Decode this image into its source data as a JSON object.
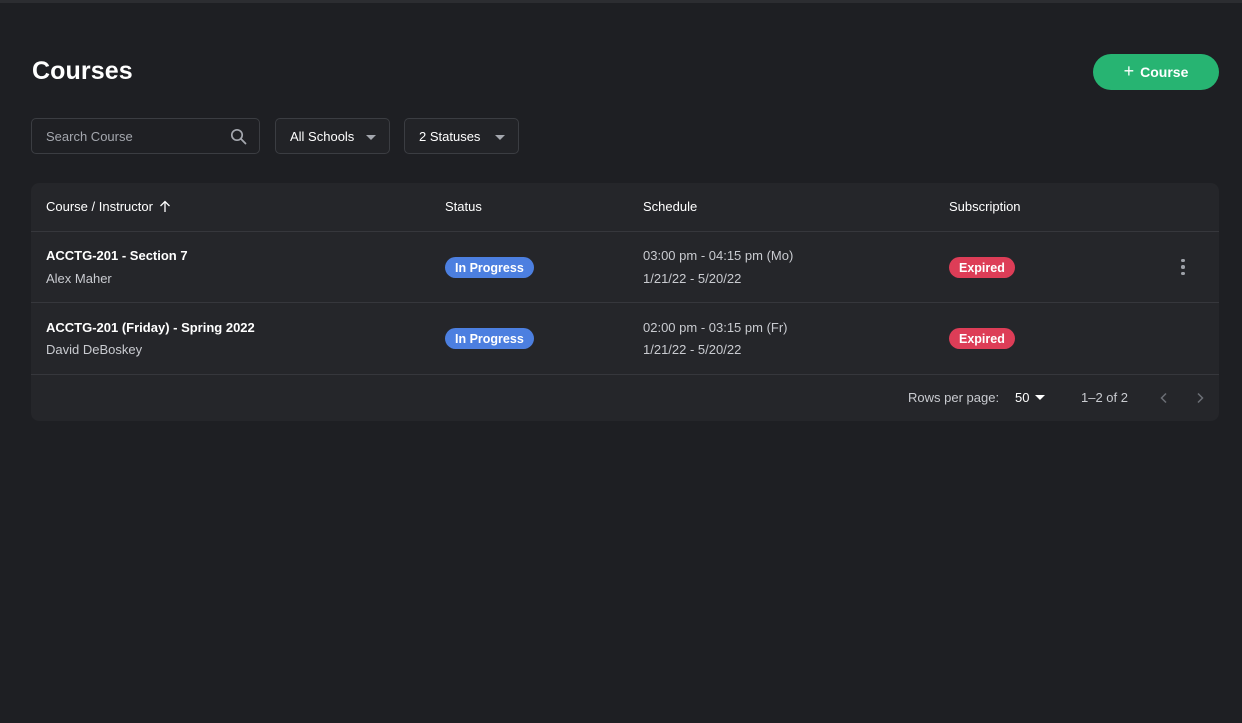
{
  "header": {
    "title": "Courses",
    "add_button": {
      "icon": "plus-icon",
      "label": "Course"
    }
  },
  "filters": {
    "search": {
      "placeholder": "Search Course",
      "value": "",
      "icon": "search-icon"
    },
    "school_dropdown": "All Schools",
    "status_dropdown": "2 Statuses"
  },
  "table": {
    "columns": [
      "Course / Instructor",
      "Status",
      "Schedule",
      "Subscription"
    ],
    "sort_icon": "arrow-up-icon",
    "rows": [
      {
        "course": "ACCTG-201 - Section 7",
        "instructor": "Alex Maher",
        "status": "In Progress",
        "schedule_time": "03:00 pm - 04:15 pm (Mo)",
        "schedule_dates": "1/21/22 - 5/20/22",
        "subscription": "Expired"
      },
      {
        "course": "ACCTG-201 (Friday) - Spring 2022",
        "instructor": "David DeBoskey",
        "status": "In Progress",
        "schedule_time": "02:00 pm - 03:15 pm (Fr)",
        "schedule_dates": "1/21/22 - 5/20/22",
        "subscription": "Expired"
      }
    ]
  },
  "pagination": {
    "rows_per_page_label": "Rows per page:",
    "rows_per_page": "50",
    "range": "1–2 of 2"
  },
  "colors": {
    "background": "#1e1f23",
    "card": "#25262a",
    "accent_green": "#27b472",
    "status_blue": "#4c7fe0",
    "expired_red": "#dd3d57"
  }
}
